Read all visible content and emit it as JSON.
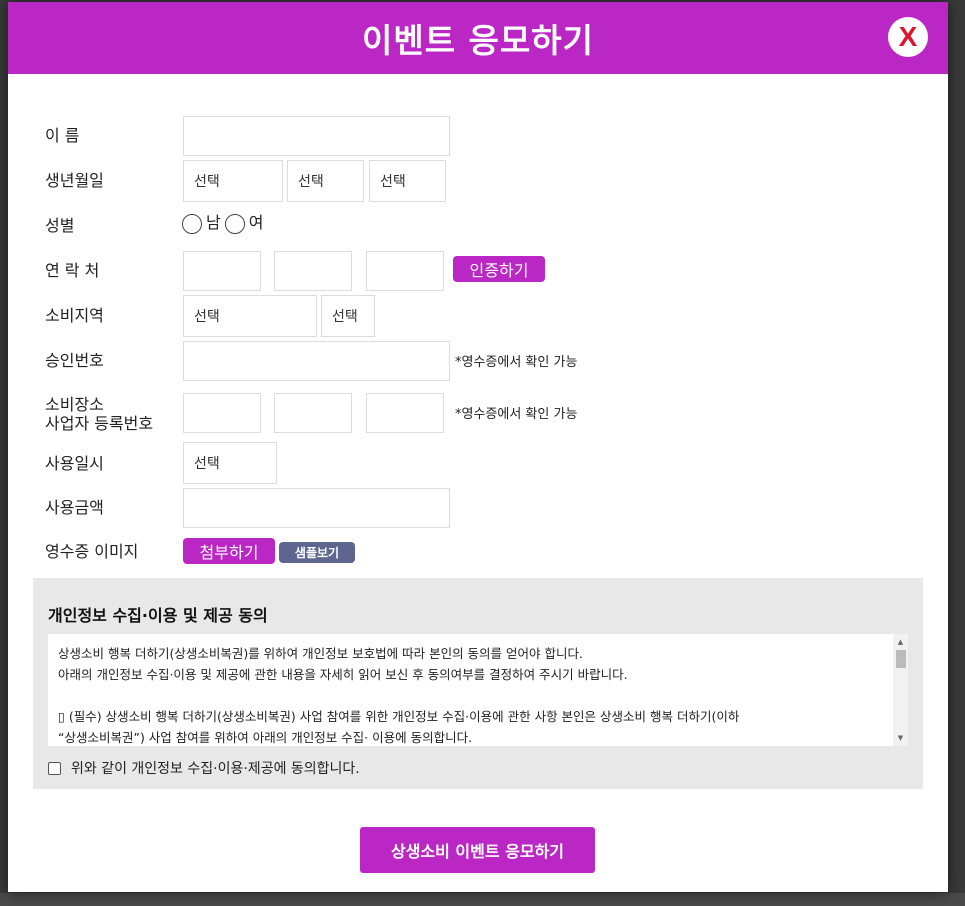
{
  "header": {
    "title": "이벤트 응모하기",
    "close_label": "X"
  },
  "form": {
    "name_label": "이 름",
    "birth_label": "생년월일",
    "birth_year": "선택",
    "birth_month": "선택",
    "birth_day": "선택",
    "gender_label": "성별",
    "gender_male": "남",
    "gender_female": "여",
    "contact_label": "연 락 처",
    "verify_button": "인증하기",
    "region_label": "소비지역",
    "region_1": "선택",
    "region_2": "선택",
    "approval_label": "승인번호",
    "approval_note": "*영수증에서 확인 가능",
    "store_label_1": "소비장소",
    "store_label_2": "사업자 등록번호",
    "store_note": "*영수증에서 확인 가능",
    "use_date_label": "사용일시",
    "use_date_value": "선택",
    "amount_label": "사용금액",
    "receipt_label": "영수증 이미지",
    "attach_button": "첨부하기",
    "sample_button": "샘플보기"
  },
  "consent": {
    "title": "개인정보 수집·이용 및 제공 동의",
    "lines": [
      "상생소비 행복 더하기(상생소비복권)를 위하여 개인정보 보호법에 따라 본인의 동의를 얻어야 합니다.",
      "아래의 개인정보 수집·이용 및 제공에 관한 내용을 자세히 읽어 보신 후 동의여부를 결정하여 주시기 바랍니다.",
      "",
      "▯ (필수) 상생소비 행복 더하기(상생소비복권) 사업 참여를 위한 개인정보 수집·이용에 관한 사항 본인은 상생소비 행복 더하기(이하",
      "“상생소비복권”) 사업 참여를 위하여 아래의 개인정보 수집· 이용에 동의합니다."
    ],
    "agree_label": "위와 같이 개인정보 수집·이용·제공에 동의합니다."
  },
  "submit": {
    "label": "상생소비 이벤트 응모하기"
  },
  "colors": {
    "accent": "#bb27c5",
    "close_x": "#e0152e",
    "sample_btn": "#5e6690"
  }
}
